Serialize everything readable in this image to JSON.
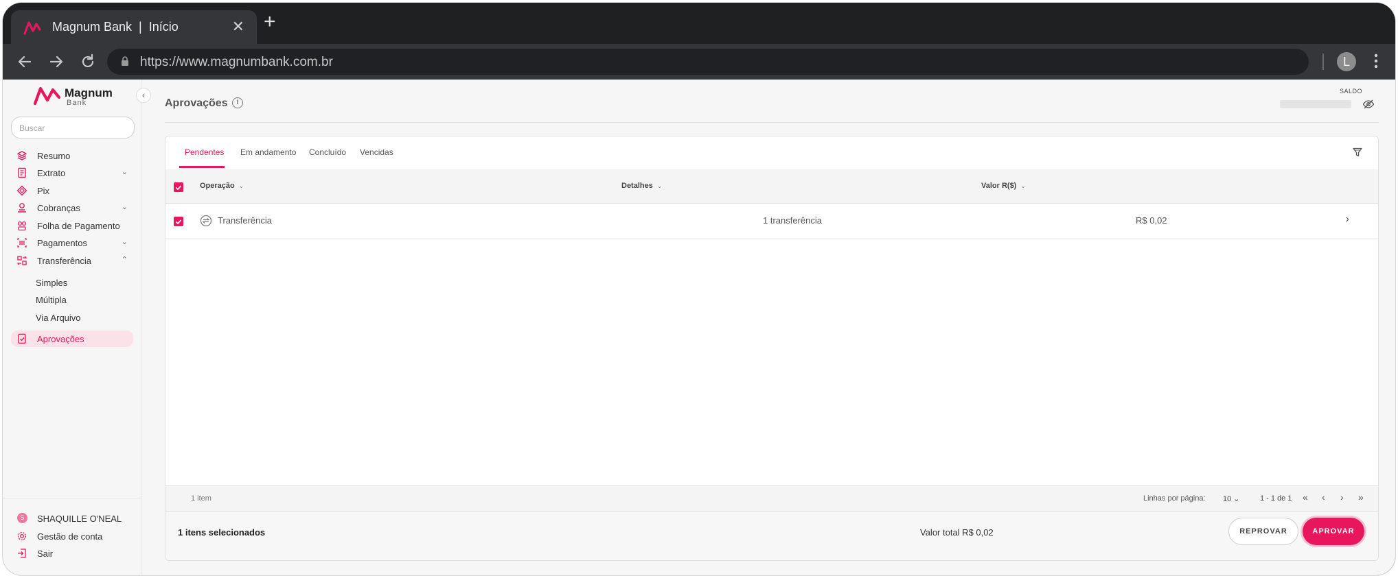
{
  "browser": {
    "tab_title": "Magnum Bank  |  Início",
    "close_glyph": "✕",
    "new_tab_glyph": "+",
    "url": "https://www.magnumbank.com.br",
    "profile_initial": "L"
  },
  "sidebar": {
    "brand_name": "Magnum",
    "brand_sub": "Bank",
    "search_placeholder": "Buscar",
    "collapse_glyph": "‹",
    "items": [
      {
        "label": "Resumo",
        "icon": "layers-icon"
      },
      {
        "label": "Extrato",
        "icon": "document-icon",
        "chevron": "⌄"
      },
      {
        "label": "Pix",
        "icon": "pix-icon"
      },
      {
        "label": "Cobranças",
        "icon": "billing-icon",
        "chevron": "⌄"
      },
      {
        "label": "Folha de Pagamento",
        "icon": "payroll-icon"
      },
      {
        "label": "Pagamentos",
        "icon": "barcode-icon",
        "chevron": "⌄"
      },
      {
        "label": "Transferência",
        "icon": "transfer-icon",
        "chevron": "⌃"
      }
    ],
    "sub_items": [
      "Simples",
      "Múltipla",
      "Via Arquivo"
    ],
    "active_item": {
      "label": "Aprovações",
      "icon": "approval-icon"
    },
    "footer": {
      "user_initial": "S",
      "user_name": "SHAQUILLE O'NEAL",
      "account": "Gestão de conta",
      "logout": "Sair"
    }
  },
  "header": {
    "title": "Aprovações",
    "info_glyph": "i",
    "saldo_label": "SALDO"
  },
  "tabs": [
    "Pendentes",
    "Em andamento",
    "Concluído",
    "Vencidas"
  ],
  "table": {
    "columns": [
      "Operação",
      "Detalhes",
      "Valor R($)"
    ],
    "sort_glyph": "⌄",
    "rows": [
      {
        "operation": "Transferência",
        "details": "1 transferência",
        "value": "R$ 0,02",
        "arrow": "›"
      }
    ],
    "footer": {
      "count": "1 item",
      "rows_per_page_label": "Linhas por página:",
      "rows_per_page": "10 ⌄",
      "range": "1 - 1 de 1",
      "first": "«",
      "prev": "‹",
      "next": "›",
      "last": "»"
    }
  },
  "selection": {
    "count_text": "1 itens selecionados",
    "total_text": "Valor total R$ 0,02",
    "reject_label": "REPROVAR",
    "approve_label": "APROVAR"
  },
  "colors": {
    "accent": "#e8175d",
    "accent_light": "#fbe1e8"
  }
}
